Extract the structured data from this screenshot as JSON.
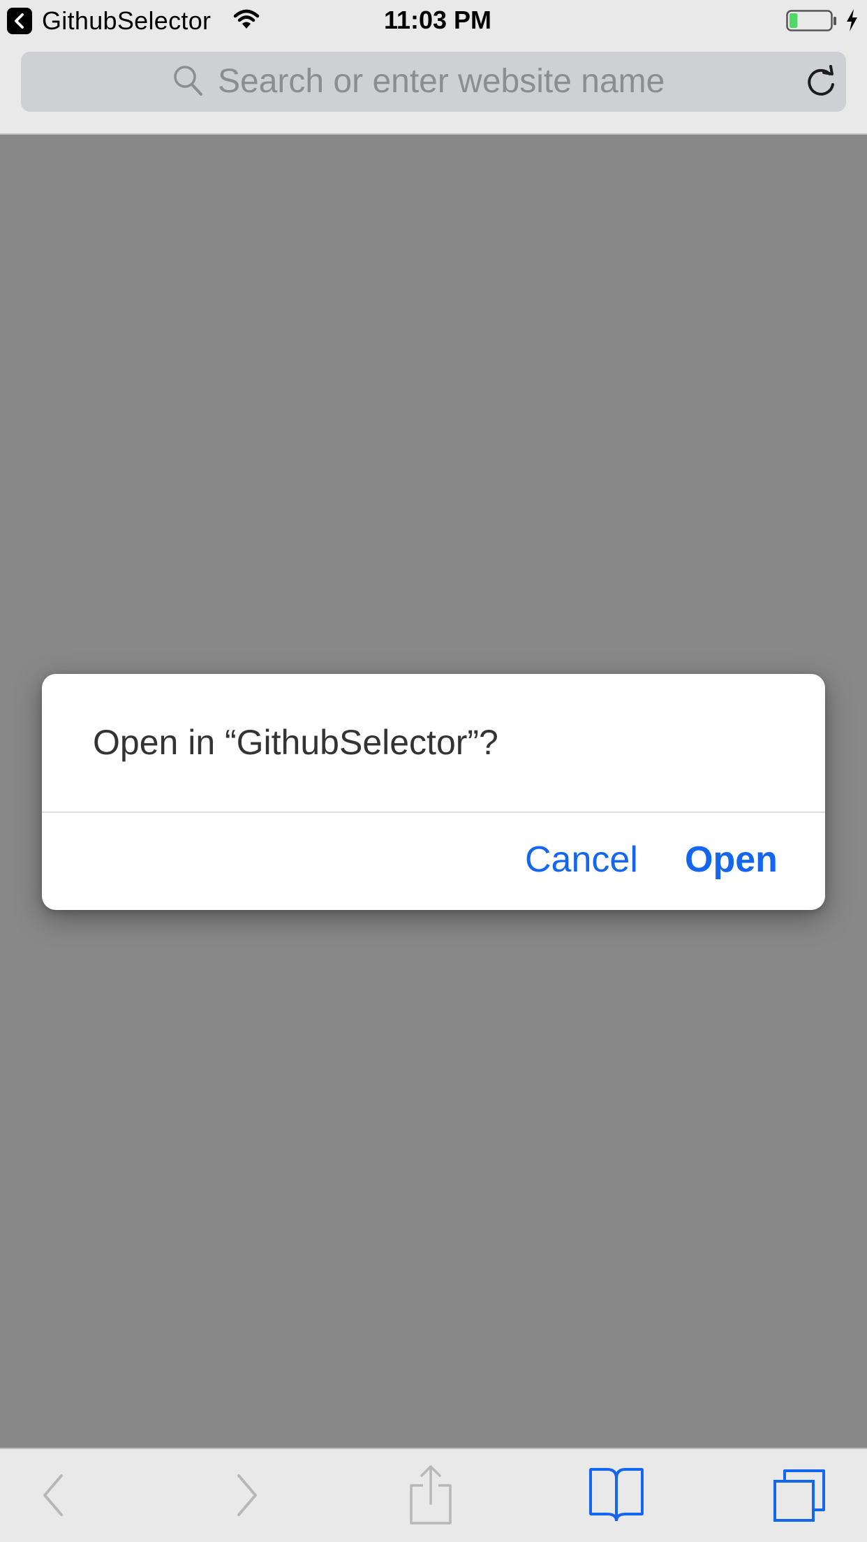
{
  "status_bar": {
    "back_app_label": "GithubSelector",
    "time": "11:03 PM",
    "back_icon": "chevron-left-icon",
    "wifi_icon": "wifi-icon",
    "battery_icon": "battery-icon",
    "charging_icon": "lightning-bolt-icon",
    "battery_level": 0.2,
    "battery_color": "#4cd964"
  },
  "address_bar": {
    "placeholder": "Search or enter website name",
    "search_icon": "search-icon",
    "reload_icon": "reload-icon"
  },
  "dialog": {
    "message": "Open in “GithubSelector”?",
    "cancel_label": "Cancel",
    "open_label": "Open",
    "button_color": "#1466f0"
  },
  "toolbar": {
    "back_icon": "chevron-left-icon",
    "forward_icon": "chevron-right-icon",
    "share_icon": "share-icon",
    "bookmarks_icon": "book-icon",
    "tabs_icon": "tabs-icon",
    "active_color": "#1466f0",
    "disabled_color": "#b7b7b9"
  },
  "colors": {
    "chrome_background": "#e9e9ea",
    "dimmed_content": "#888888"
  }
}
